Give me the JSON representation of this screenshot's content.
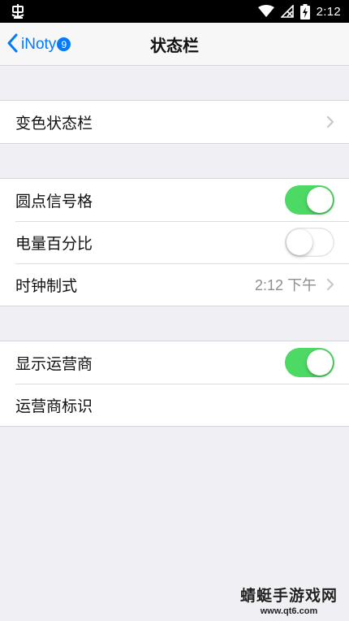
{
  "system_status": {
    "time": "2:12",
    "icons": [
      "bug-icon",
      "wifi-icon",
      "no-signal-icon",
      "battery-charging-icon"
    ]
  },
  "nav": {
    "back_label": "iNoty",
    "badge": "9",
    "title": "状态栏"
  },
  "groups": [
    {
      "rows": [
        {
          "label": "变色状态栏",
          "accessory": "chevron"
        }
      ]
    },
    {
      "rows": [
        {
          "label": "圆点信号格",
          "accessory": "toggle",
          "on": true
        },
        {
          "label": "电量百分比",
          "accessory": "toggle",
          "on": false
        },
        {
          "label": "时钟制式",
          "value": "2:12 下午",
          "accessory": "chevron"
        }
      ]
    },
    {
      "rows": [
        {
          "label": "显示运营商",
          "accessory": "toggle",
          "on": true
        },
        {
          "label": "运营商标识",
          "accessory": "none"
        }
      ]
    }
  ],
  "watermark": {
    "main": "蜻蜓手游戏网",
    "sub": "www.qt6.com"
  },
  "colors": {
    "accent": "#007aff",
    "toggle_on": "#4cd964",
    "background": "#efeff4"
  }
}
